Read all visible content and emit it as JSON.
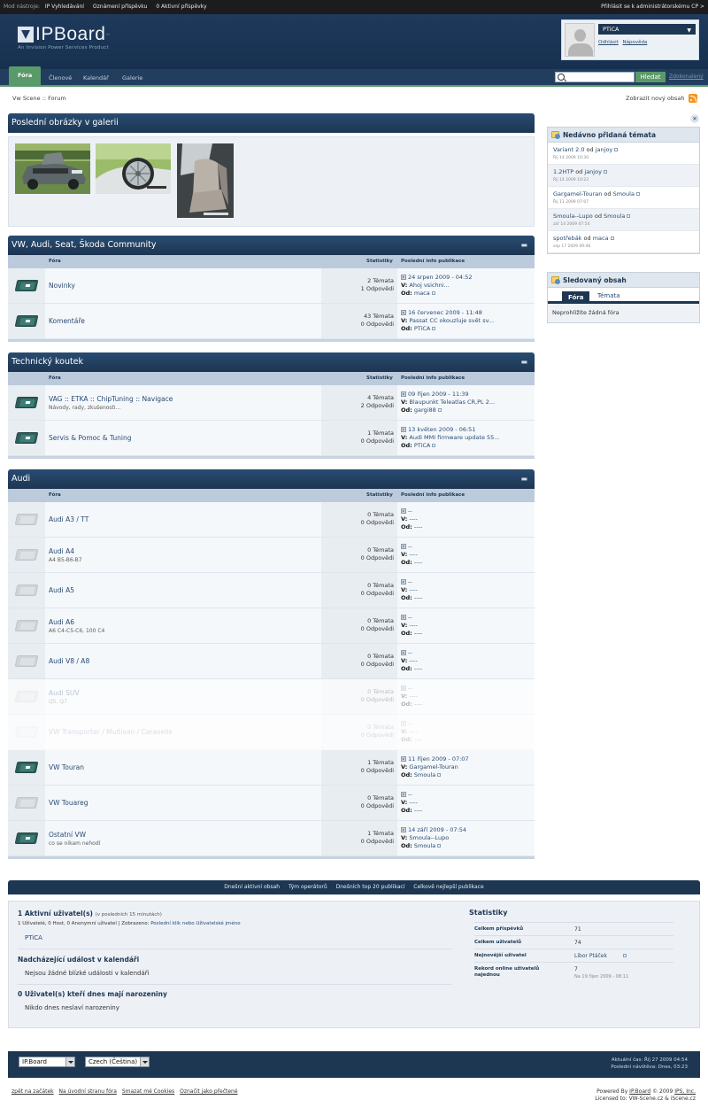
{
  "adminbar": {
    "label": "Mod nástroje:",
    "items": [
      "IP Vyhledávání",
      "Oznámení příspěvku",
      "0 Aktivní příspěvky"
    ],
    "right": "Přihlásit se k administrátorskému CP >"
  },
  "header": {
    "logo": "IPBoard",
    "logo_tm": "™",
    "tagline": "An Invision Power Services Product"
  },
  "user": {
    "name": "PTiCA",
    "logout": "Odhlásit",
    "help": "Nápověda"
  },
  "nav": {
    "tabs": [
      "Fóra",
      "Členové",
      "Kalendář",
      "Galerie"
    ],
    "search_button": "Hledat",
    "advanced": "Zdokonalený"
  },
  "breadcrumb": "Vw Scene :: Forum",
  "new_content": "Zobrazit nový obsah",
  "gallery": {
    "title": "Poslední obrázky v galerii"
  },
  "columns": {
    "forum": "Fóra",
    "stats": "Statistiky",
    "last": "Poslední info publikace"
  },
  "categories": [
    {
      "title": "VW, Audi, Seat, Škoda Community",
      "forums": [
        {
          "name": "Novinky",
          "desc": "",
          "topics": "2 Témata",
          "replies": "1 Odpovědi",
          "date": "24 srpen 2009 - 04:52",
          "in": "Ahoj vsichni...",
          "by": "maca",
          "new": true
        },
        {
          "name": "Komentáře",
          "desc": "",
          "topics": "43 Témata",
          "replies": "0 Odpovědi",
          "date": "16 červenec 2009 - 11:48",
          "in": "Passat CC okouzluje svět sv...",
          "by": "PTiCA",
          "new": true
        }
      ]
    },
    {
      "title": "Technický koutek",
      "forums": [
        {
          "name": "VAG :: ETKA :: ChipTuning :: Navigace",
          "desc": "Návody, rady, zkušenosti...",
          "topics": "4 Témata",
          "replies": "2 Odpovědi",
          "date": "09 říjen 2009 - 11:39",
          "in": "Blaupunkt Teleatlas CR,PL 2...",
          "by": "gargi88",
          "new": true
        },
        {
          "name": "Servis & Pomoc & Tuning",
          "desc": "",
          "topics": "1 Témata",
          "replies": "0 Odpovědi",
          "date": "13 květen 2009 - 06:51",
          "in": "Audi MMI firmware update 55...",
          "by": "PTiCA",
          "new": true
        }
      ]
    },
    {
      "title": "Audi",
      "forums": [
        {
          "name": "Audi A3 / TT",
          "desc": "",
          "topics": "0 Témata",
          "replies": "0 Odpovědi",
          "date": "--",
          "in": "----",
          "by": "----",
          "new": false
        },
        {
          "name": "Audi A4",
          "desc": "A4 B5-B6-B7",
          "topics": "0 Témata",
          "replies": "0 Odpovědi",
          "date": "--",
          "in": "----",
          "by": "----",
          "new": false
        },
        {
          "name": "Audi A5",
          "desc": "",
          "topics": "0 Témata",
          "replies": "0 Odpovědi",
          "date": "--",
          "in": "----",
          "by": "----",
          "new": false
        },
        {
          "name": "Audi A6",
          "desc": "A6 C4-C5-C6, 100 C4",
          "topics": "0 Témata",
          "replies": "0 Odpovědi",
          "date": "--",
          "in": "----",
          "by": "----",
          "new": false
        },
        {
          "name": "Audi V8 / A8",
          "desc": "",
          "topics": "0 Témata",
          "replies": "0 Odpovědi",
          "date": "--",
          "in": "----",
          "by": "----",
          "new": false
        },
        {
          "name": "Audi SUV",
          "desc": "Q5, Q7",
          "topics": "0 Témata",
          "replies": "0 Odpovědi",
          "date": "--",
          "in": "----",
          "by": "----",
          "new": false
        },
        {
          "name": "VW Transporter / Multivan / Caravelle",
          "desc": "",
          "topics": "0 Témata",
          "replies": "0 Odpovědi",
          "date": "--",
          "in": "----",
          "by": "----",
          "new": false
        },
        {
          "name": "VW Touran",
          "desc": "",
          "topics": "1 Témata",
          "replies": "0 Odpovědi",
          "date": "11 říjen 2009 - 07:07",
          "in": "Gargamel-Touran",
          "by": "Smoula",
          "new": true
        },
        {
          "name": "VW Touareg",
          "desc": "",
          "topics": "0 Témata",
          "replies": "0 Odpovědi",
          "date": "--",
          "in": "----",
          "by": "----",
          "new": false
        },
        {
          "name": "Ostatní VW",
          "desc": "co se nikam nehodí",
          "topics": "1 Témata",
          "replies": "0 Odpovědi",
          "date": "14 září 2009 - 07:54",
          "in": "Smoula--Lupo",
          "by": "Smoula",
          "new": true
        }
      ]
    }
  ],
  "labels": {
    "in": "V:",
    "by": "Od:"
  },
  "sidebar": {
    "recent_title": "Nedávno přidaná témata",
    "recent": [
      {
        "topic": "Variant 2.0",
        "od": "od",
        "user": "janjoy",
        "date": "Říj 14 2009 10:30"
      },
      {
        "topic": "1.2HTP",
        "od": "od",
        "user": "janjoy",
        "date": "Říj 14 2009 10:22"
      },
      {
        "topic": "Gargamel-Touran",
        "od": "od",
        "user": "Smoula",
        "date": "Říj 11 2009 07:07"
      },
      {
        "topic": "Smoula--Lupo",
        "od": "od",
        "user": "Smoula",
        "date": "zář 14 2009 07:54"
      },
      {
        "topic": "spotřebák",
        "od": "od",
        "user": "maca",
        "date": "sep 17 2009 09:46"
      }
    ],
    "watched_title": "Sledovaný obsah",
    "watched_tabs": [
      "Fóra",
      "Témata"
    ],
    "watched_empty": "Neprohlížíte žádná fóra"
  },
  "statsbar": [
    "Dnešní aktivní obsah",
    "Tým operátorů",
    "Dnešních top 20 publikací",
    "Celkově nejlepší publikace"
  ],
  "online": {
    "title": "1 Aktivní uživatel(s)",
    "title_note": "(v posledních 15 minutách)",
    "summary_prefix": "1 Uživatelé, 0 Host, 0 Anonymní uživatel | Zobrazeno:",
    "summary_link": "Poslední klik nebo Uživatelské jméno",
    "user": "PTiCA",
    "events_title": "Nadcházející událost v kalendáři",
    "events_text": "Nejsou žádné blízké události v kalendáři",
    "birthdays_title": "0 Uživatel(s) kteří dnes mají narozeniny",
    "birthdays_text": "Nikdo dnes neslaví narozeniny"
  },
  "board_stats": {
    "title": "Statistiky",
    "rows": [
      {
        "k": "Celkem příspěvků",
        "v": "71"
      },
      {
        "k": "Celkem uživatelů",
        "v": "74"
      },
      {
        "k": "Nejnovější uživatel",
        "v": "Libor Ptáček"
      },
      {
        "k": "Rekord online uživatelů najednou",
        "v": "7",
        "sub": "Na 19 říjen 2009 - 08:11"
      }
    ]
  },
  "footer": {
    "skin": "IP.Board",
    "lang": "Czech (Čeština)",
    "time1": "Aktuální čas: Říj 27 2009 04:54",
    "time2": "Poslední návštěva: Dnes, 03:23",
    "links": [
      "zpět na začátek",
      "Na úvodní stranu fóra",
      "Smazat mé Cookies",
      "Označit jako přečtené"
    ],
    "powered_prefix": "Powered By",
    "powered_brand": "IP.Board",
    "powered_mid": "© 2009",
    "powered_company": "IPS, Inc.",
    "licensed": "Licensed to: VW-Scene.cz & iScene.cz"
  },
  "colors": {
    "header": "#1e3a5c",
    "nav_active": "#5a9a6a",
    "category_header": "#1d3652",
    "link": "#284b72"
  }
}
